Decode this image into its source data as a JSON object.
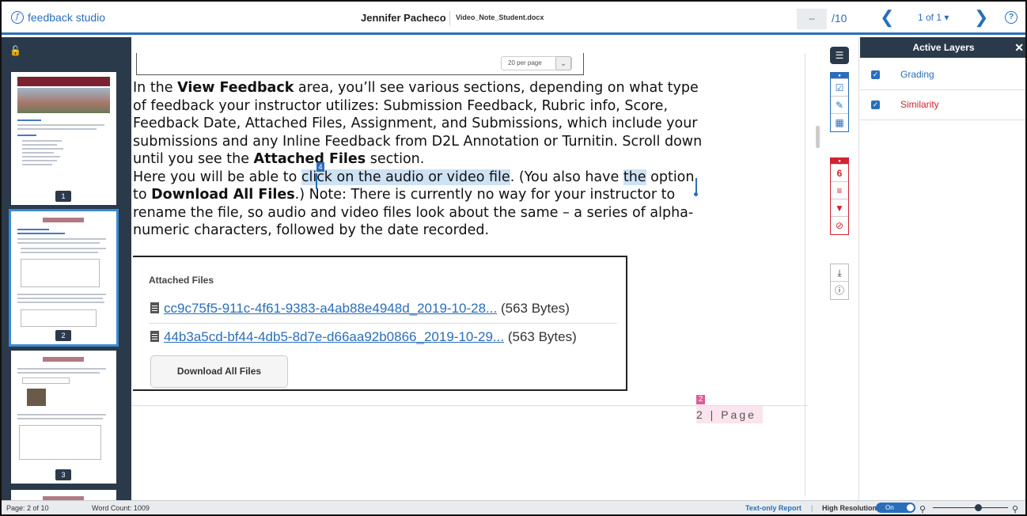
{
  "header": {
    "logo_text": "feedback studio",
    "student_name": "Jennifer Pacheco",
    "file_name": "Video_Note_Student.docx",
    "score_value": "--",
    "score_max": "/10",
    "page_indicator": "1 of 1 ▾"
  },
  "thumbnails": [
    {
      "page": "1"
    },
    {
      "page": "2"
    },
    {
      "page": "3"
    }
  ],
  "doc": {
    "per_page": "20 per page",
    "lines": [
      {
        "pre": "In the ",
        "bold": "View Feedback",
        "post": " area, you’ll see various sections, depending on what type"
      },
      {
        "text": "of feedback your instructor utilizes: Submission Feedback, Rubric info, Score,"
      },
      {
        "text": "Feedback Date, Attached Files, Assignment, and Submissions, which include your"
      },
      {
        "text": "submissions and any Inline Feedback from D2L Annotation or Turnitin. Scroll down"
      },
      {
        "pre": "until you see the ",
        "bold": "Attached Files",
        "post": " section."
      }
    ],
    "line6": {
      "pre": "Here you will be able to ",
      "highlight": "click on the audio or video file",
      "mid": ". (You also have ",
      "highlight2": "the",
      "post": " option"
    },
    "line7": {
      "pre": "to ",
      "bold": "Download All Files",
      "post": ".) Note: There is currently no way for your instructor to"
    },
    "line8": {
      "text": "rename the file, so audio and video files look about the same – a series of alpha-"
    },
    "line9": {
      "text": "numeric characters, followed by the date recorded."
    },
    "cursor_label": "4",
    "attached_title": "Attached Files",
    "files": [
      {
        "name": "cc9c75f5-911c-4f61-9383-a4ab88e4948d_2019-10-28...",
        "size": "(563 Bytes)"
      },
      {
        "name": "44b3a5cd-bf44-4db5-8d7e-d66aa92b0866_2019-10-29...",
        "size": "(563 Bytes)"
      }
    ],
    "download_all": "Download All Files",
    "footer_page_marker": "2",
    "footer_page": "2 | Page"
  },
  "rail": {
    "similarity_count": "6"
  },
  "layers": {
    "title": "Active Layers",
    "items": [
      {
        "label": "Grading",
        "color": "#2a6ebb"
      },
      {
        "label": "Similarity",
        "color": "#d0242f"
      }
    ]
  },
  "status": {
    "page": "Page: 2 of 10",
    "word_count": "Word Count: 1009",
    "text_only": "Text-only Report",
    "high_res": "High Resolution",
    "toggle": "On"
  },
  "colors": {
    "accent": "#2a6ebb",
    "similarity": "#d0242f",
    "sidebar": "#2b3a4a"
  }
}
